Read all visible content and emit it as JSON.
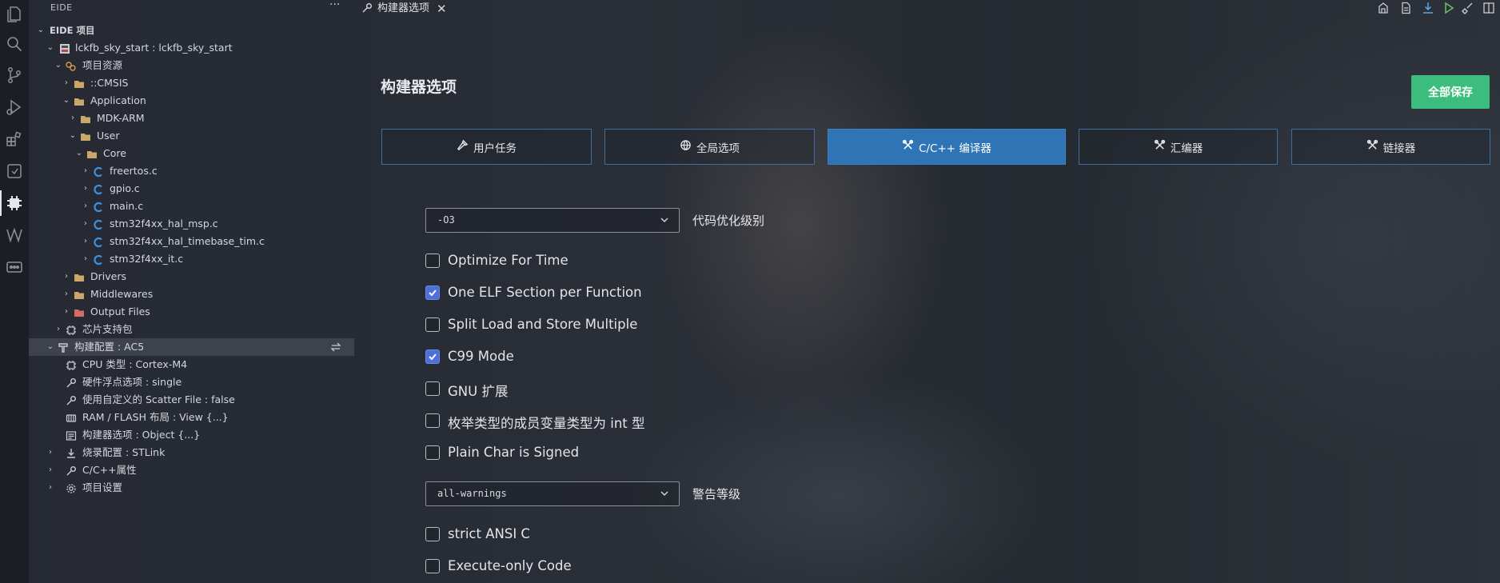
{
  "sidebar": {
    "header": "EIDE",
    "more": "···",
    "section_title": "EIDE 项目",
    "project": "lckfb_sky_start : lckfb_sky_start",
    "items": {
      "resources": "项目资源",
      "cmsis": "::CMSIS",
      "application": "Application",
      "mdk_arm": "MDK-ARM",
      "user": "User",
      "core": "Core",
      "freertos": "freertos.c",
      "gpio": "gpio.c",
      "main": "main.c",
      "hal_msp": "stm32f4xx_hal_msp.c",
      "hal_timebase": "stm32f4xx_hal_timebase_tim.c",
      "it": "stm32f4xx_it.c",
      "drivers": "Drivers",
      "middlewares": "Middlewares",
      "output_files": "Output Files",
      "chip_pack": "芯片支持包",
      "build_config": "构建配置 : AC5",
      "cpu_type": "CPU 类型 : Cortex-M4",
      "fpu": "硬件浮点选项 : single",
      "scatter": "使用自定义的 Scatter File : false",
      "ram_flash": "RAM / FLASH 布局 : View {...}",
      "builder_opts": "构建器选项 : Object {...}",
      "flash_config": "烧录配置 : STLink",
      "cpp_props": "C/C++属性",
      "project_settings": "项目设置"
    }
  },
  "tab": {
    "label": "构建器选项",
    "close": "✕"
  },
  "main": {
    "title": "构建器选项",
    "save_all": "全部保存",
    "nav_tabs": {
      "user_tasks": "用户任务",
      "global": "全局选项",
      "cc": "C/C++ 编译器",
      "asm": "汇编器",
      "linker": "链接器"
    },
    "optimization": {
      "value": "-O3",
      "label": "代码优化级别"
    },
    "warnings": {
      "value": "all-warnings",
      "label": "警告等级"
    },
    "options": [
      {
        "label": "Optimize For Time",
        "checked": false
      },
      {
        "label": "One ELF Section per Function",
        "checked": true
      },
      {
        "label": "Split Load and Store Multiple",
        "checked": false
      },
      {
        "label": "C99 Mode",
        "checked": true
      },
      {
        "label": "GNU 扩展",
        "checked": false
      },
      {
        "label": "枚举类型的成员变量类型为 int 型",
        "checked": false
      },
      {
        "label": "Plain Char is Signed",
        "checked": false
      }
    ],
    "options2": [
      {
        "label": "strict ANSI C",
        "checked": false
      },
      {
        "label": "Execute-only Code",
        "checked": false
      }
    ]
  },
  "colors": {
    "accent": "#2f74b5",
    "save_button": "#3dbd7d",
    "checkbox_on": "#4d6fd9",
    "c_file_icon": "#3b8fe0",
    "folder_icon": "#c9a86a"
  }
}
